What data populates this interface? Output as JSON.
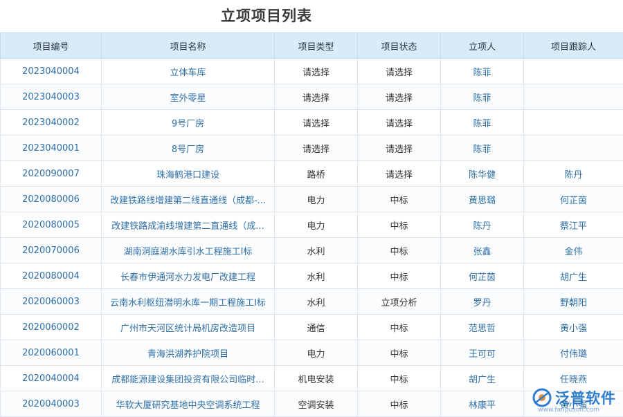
{
  "page": {
    "title": "立项项目列表"
  },
  "table": {
    "columns": [
      "项目编号",
      "项目名称",
      "项目类型",
      "项目状态",
      "立项人",
      "项目跟踪人"
    ],
    "rows": [
      {
        "id": "2023040004",
        "name": "立体车库",
        "type": "请选择",
        "status": "请选择",
        "person": "陈菲",
        "tracker": ""
      },
      {
        "id": "2023040003",
        "name": "室外零星",
        "type": "请选择",
        "status": "请选择",
        "person": "陈菲",
        "tracker": ""
      },
      {
        "id": "2023040002",
        "name": "9号厂房",
        "type": "请选择",
        "status": "请选择",
        "person": "陈菲",
        "tracker": ""
      },
      {
        "id": "2023040001",
        "name": "8号厂房",
        "type": "请选择",
        "status": "请选择",
        "person": "陈菲",
        "tracker": ""
      },
      {
        "id": "2020090007",
        "name": "珠海鹤港口建设",
        "type": "路桥",
        "status": "请选择",
        "person": "陈华健",
        "tracker": "陈丹"
      },
      {
        "id": "2020080006",
        "name": "改建铁路线增建第二线直通线（成都-...",
        "type": "电力",
        "status": "中标",
        "person": "黄思璐",
        "tracker": "何芷茵"
      },
      {
        "id": "2020080005",
        "name": "改建铁路成渝线增建第二直通线（成...",
        "type": "电力",
        "status": "中标",
        "person": "陈丹",
        "tracker": "蔡江平"
      },
      {
        "id": "2020070006",
        "name": "湖南洞庭湖水库引水工程施工I标",
        "type": "水利",
        "status": "中标",
        "person": "张鑫",
        "tracker": "金伟"
      },
      {
        "id": "2020080004",
        "name": "长春市伊通河水力发电厂改建工程",
        "type": "水利",
        "status": "中标",
        "person": "何芷茵",
        "tracker": "胡广生"
      },
      {
        "id": "2020060003",
        "name": "云南水利枢纽潜明水库一期工程施工I标",
        "type": "水利",
        "status": "立项分析",
        "person": "罗丹",
        "tracker": "野朝阳"
      },
      {
        "id": "2020060002",
        "name": "广州市天河区统计局机房改造项目",
        "type": "通信",
        "status": "中标",
        "person": "范思哲",
        "tracker": "黄小强"
      },
      {
        "id": "2020060001",
        "name": "青海洪湖养护院项目",
        "type": "电力",
        "status": "中标",
        "person": "王可可",
        "tracker": "付伟璐"
      },
      {
        "id": "2020040004",
        "name": "成都能源建设集团投资有限公司临时...",
        "type": "机电安装",
        "status": "中标",
        "person": "胡广生",
        "tracker": "任晓燕"
      },
      {
        "id": "2020040003",
        "name": "华软大厦研究基地中央空调系统工程",
        "type": "空调安装",
        "status": "中标",
        "person": "林康平",
        "tracker": "黄小强"
      }
    ]
  },
  "watermark": {
    "brand": "泛普软件",
    "url": "www.fanpusoft.com",
    "color": "#1f72c9"
  }
}
